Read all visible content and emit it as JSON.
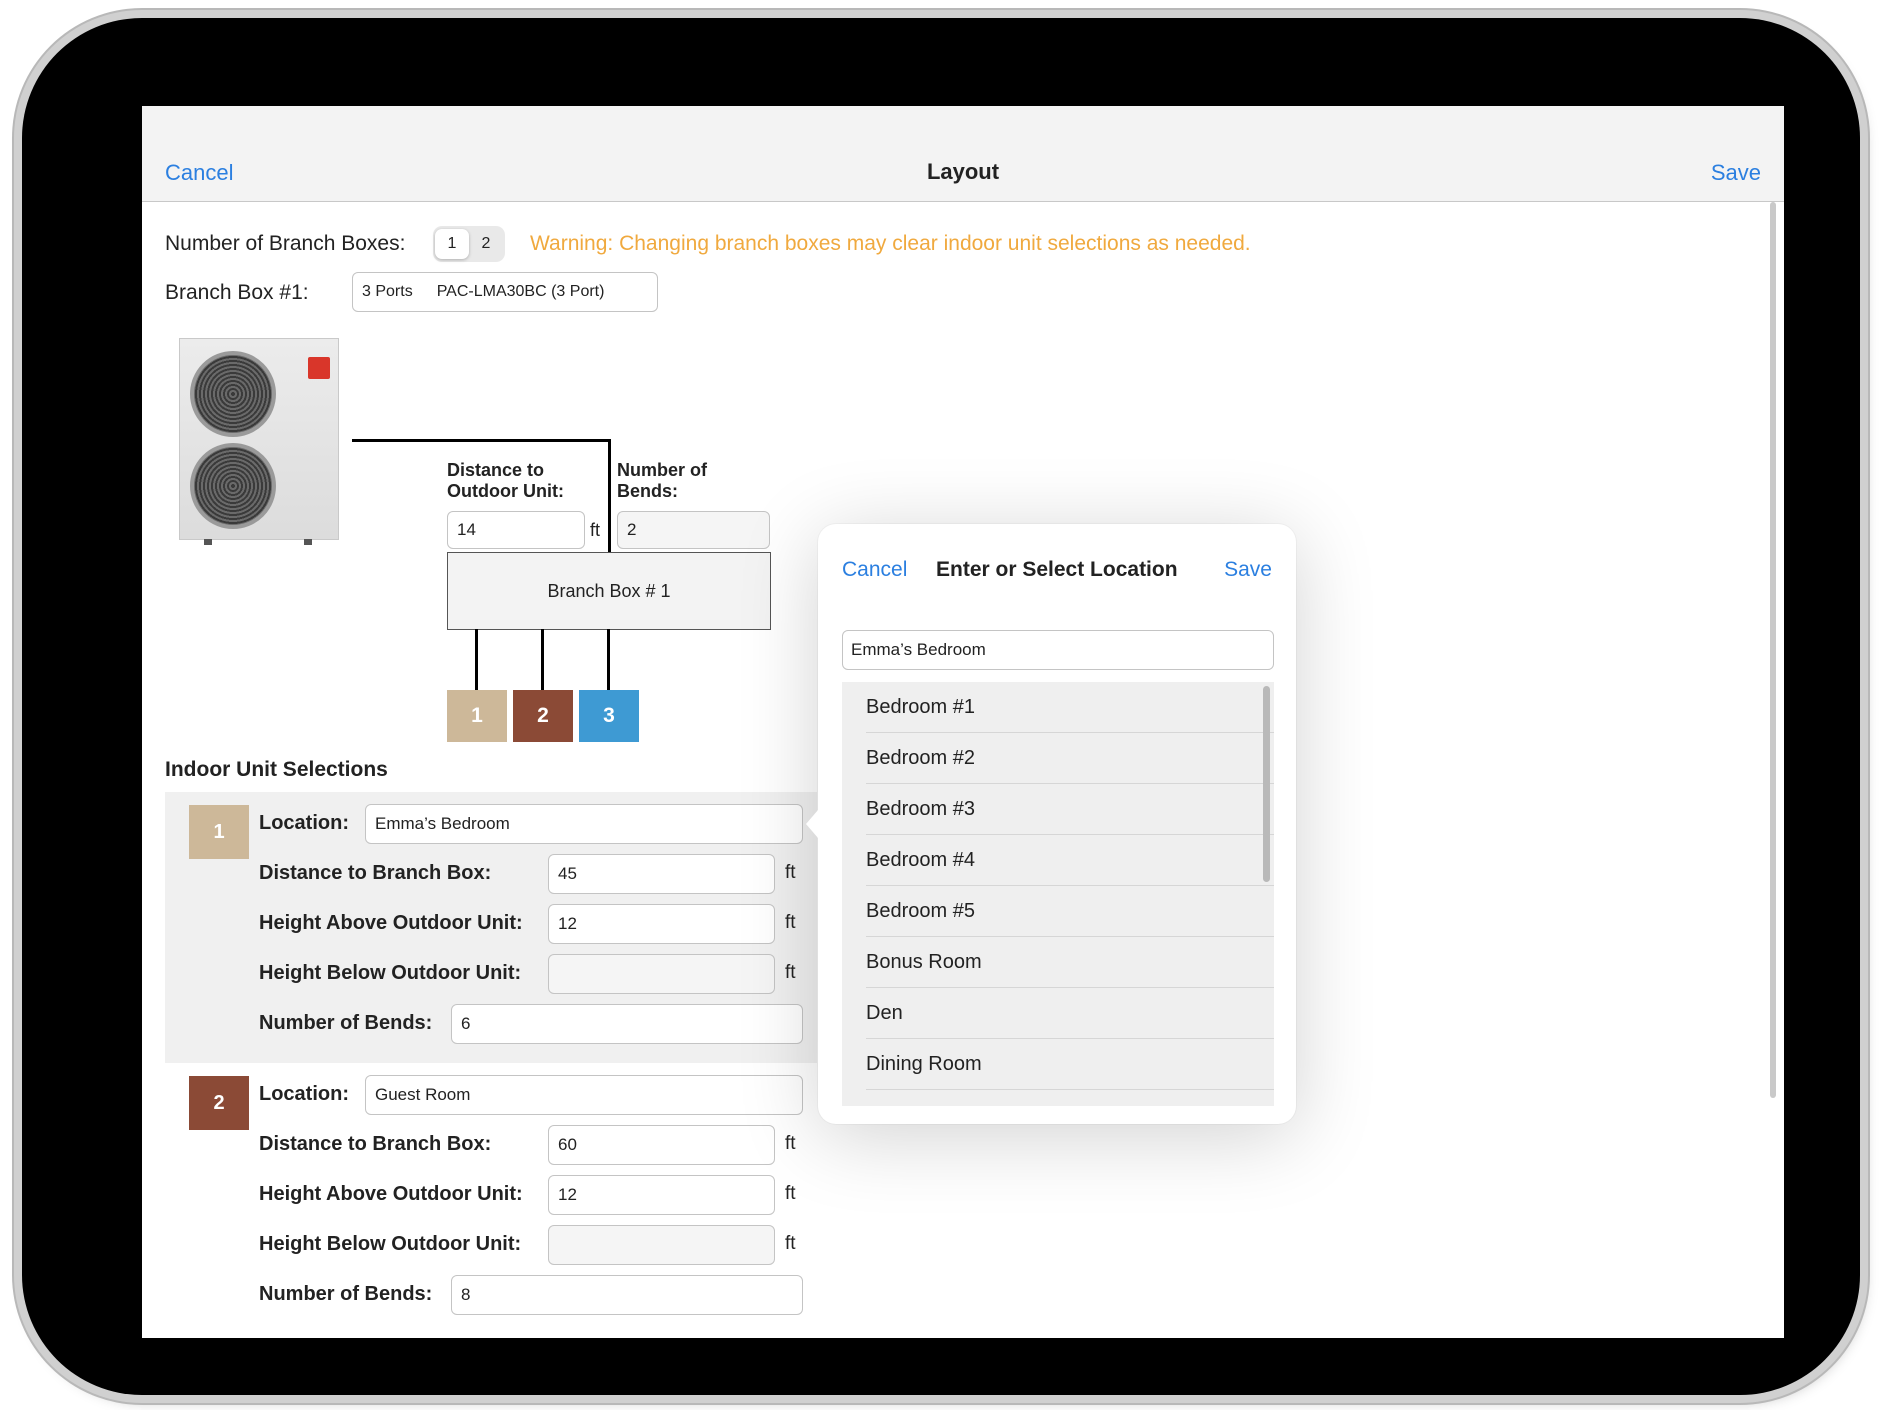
{
  "nav": {
    "cancel": "Cancel",
    "title": "Layout",
    "save": "Save"
  },
  "branch": {
    "count_label": "Number of Branch Boxes:",
    "options": [
      "1",
      "2"
    ],
    "selected": "1",
    "warning": "Warning: Changing branch boxes may clear indoor unit selections as needed.",
    "box1_label": "Branch Box #1:",
    "box1_ports": "3 Ports",
    "box1_model": "PAC-LMA30BC (3 Port)"
  },
  "diagram": {
    "distance_label_line1": "Distance to",
    "distance_label_line2": "Outdoor Unit:",
    "distance_value": "14",
    "distance_unit": "ft",
    "bends_label_line1": "Number of",
    "bends_label_line2": "Bends:",
    "bends_value": "2",
    "branch_box_label": "Branch Box # 1",
    "ports": [
      {
        "label": "1",
        "color": "#cdb899"
      },
      {
        "label": "2",
        "color": "#8b4a36"
      },
      {
        "label": "3",
        "color": "#3e9ad3"
      }
    ]
  },
  "indoor": {
    "title": "Indoor Unit Selections",
    "labels": {
      "location": "Location:",
      "distance": "Distance to Branch Box:",
      "height_above": "Height Above Outdoor Unit:",
      "height_below": "Height Below Outdoor Unit:",
      "bends": "Number of Bends:",
      "unit": "ft"
    },
    "units": [
      {
        "number": "1",
        "color": "#cdb899",
        "location": "Emma’s Bedroom",
        "distance": "45",
        "height_above": "12",
        "height_below": "",
        "bends": "6"
      },
      {
        "number": "2",
        "color": "#8b4a36",
        "location": "Guest Room",
        "distance": "60",
        "height_above": "12",
        "height_below": "",
        "bends": "8"
      }
    ]
  },
  "popover": {
    "cancel": "Cancel",
    "title": "Enter or Select Location",
    "save": "Save",
    "input_value": "Emma’s Bedroom",
    "items": [
      "Bedroom #1",
      "Bedroom #2",
      "Bedroom #3",
      "Bedroom #4",
      "Bedroom #5",
      "Bonus Room",
      "Den",
      "Dining Room"
    ]
  }
}
